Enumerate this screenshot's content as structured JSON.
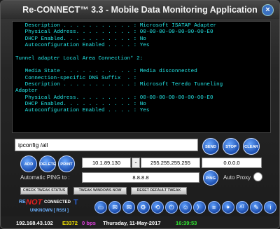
{
  "window": {
    "title": "Re-CONNECT™ 3.3 - Mobile Data Monitoring Application",
    "close_glyph": "×"
  },
  "console": {
    "lines": [
      "   Description . . . . . . . . . . . : Microsoft ISATAP Adapter",
      "   Physical Address. . . . . . . . . : 00-00-00-00-00-00-00-E0",
      "   DHCP Enabled. . . . . . . . . . . : No",
      "   Autoconfiguration Enabled . . . . : Yes",
      "",
      "Tunnel adapter Local Area Connection* 2:",
      "",
      "   Media State . . . . . . . . . . . : Media disconnected",
      "   Connection-specific DNS Suffix  . :",
      "   Description . . . . . . . . . . . : Microsoft Teredo Tunneling",
      "Adapter",
      "   Physical Address. . . . . . . . . : 00-00-00-00-00-00-00-E0",
      "   DHCP Enabled. . . . . . . . . . . : No",
      "   Autoconfiguration Enabled . . . . : Yes",
      "",
      ""
    ]
  },
  "command": {
    "value": "ipconfig /all"
  },
  "buttons": {
    "send": "SEND",
    "stop": "STOP",
    "clear": "CLEAR",
    "add": "ADD",
    "delete": "DELETE",
    "print": "PRINT",
    "ping": "PING"
  },
  "network": {
    "ip": "10.1.89.130",
    "subnet": "255.255.255.255",
    "gateway": "0.0.0.0",
    "ping_label": "Automatic PING to :",
    "ping_target": "8.8.8.8",
    "auto_proxy_label": "Auto Proxy"
  },
  "tweak": {
    "check": "CHECK TWEAK STATUS",
    "windows": "TWEAK WINDOWS NOW",
    "reset": "RESET DEFAULT TWEAK"
  },
  "logo": {
    "prefix": "RE",
    "not": "NOT",
    "connected": "CONNECTED",
    "suffix": "T",
    "sub": "UNKNOWN [ RSSI ]"
  },
  "toolbar_icons": [
    "desktop-icon",
    "chat-icon",
    "mail-icon",
    "settings-icon",
    "speed-icon",
    "info-icon"
  ],
  "toolbar_glyphs": [
    "▭",
    "✉",
    "✉",
    "⚙",
    "⟲",
    "⏻",
    "☺",
    "〉",
    "≡",
    "✦",
    "AT",
    "✎",
    "i"
  ],
  "status": {
    "ip": "192.168.43.102",
    "code": "E3372",
    "bps": "0 bps",
    "date": "Thursday, 11-May-2017",
    "time": "16:39:53"
  },
  "colors": {
    "console_text": "#22e6e6",
    "status_ip": "#ffffff",
    "status_code": "#f6e600",
    "status_bps": "#e040e0",
    "status_date": "#ffffff",
    "status_time": "#2fe62f"
  }
}
